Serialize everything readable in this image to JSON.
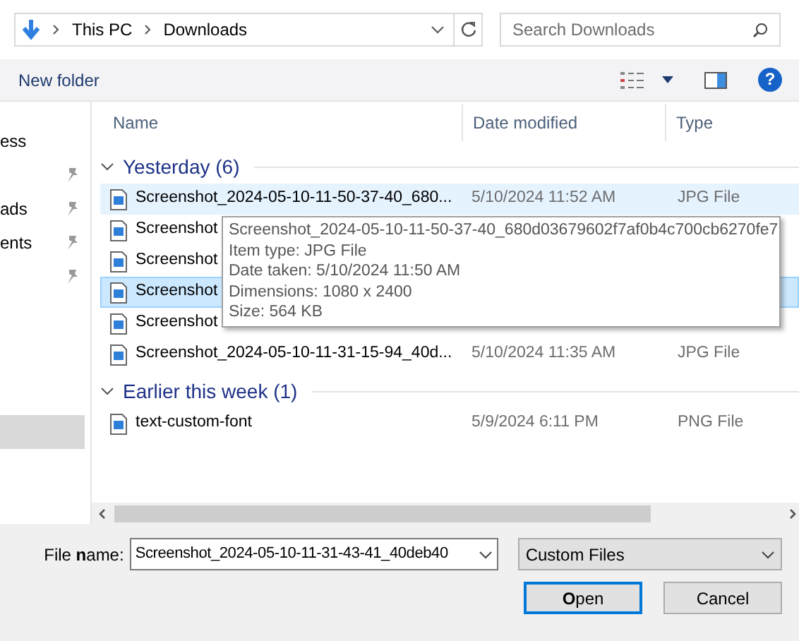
{
  "address_bar": {
    "path": [
      "This PC",
      "Downloads"
    ]
  },
  "search": {
    "placeholder": "Search Downloads"
  },
  "toolbar": {
    "new_folder": "New folder",
    "help": "?"
  },
  "nav_pane": {
    "items": [
      {
        "label": "ess",
        "pinned": false
      },
      {
        "pinned": true
      },
      {
        "label": "ads",
        "pinned": true
      },
      {
        "label": "ents",
        "pinned": true
      },
      {
        "pinned": true
      }
    ]
  },
  "columns": [
    "Name",
    "Date modified",
    "Type"
  ],
  "groups": [
    {
      "title": "Yesterday (6)",
      "expanded": true,
      "files": [
        {
          "name": "Screenshot_2024-05-10-11-50-37-40_680...",
          "date": "5/10/2024 11:52 AM",
          "type": "JPG File",
          "hovered": true,
          "selected": false
        },
        {
          "name": "Screenshot",
          "hovered": false,
          "selected": false
        },
        {
          "name": "Screenshot",
          "hovered": false,
          "selected": false
        },
        {
          "name": "Screenshot",
          "hovered": false,
          "selected": true
        },
        {
          "name": "Screenshot",
          "hovered": false,
          "selected": false
        },
        {
          "name": "Screenshot_2024-05-10-11-31-15-94_40d...",
          "date": "5/10/2024 11:35 AM",
          "type": "JPG File",
          "hovered": false,
          "selected": false
        }
      ]
    },
    {
      "title": "Earlier this week (1)",
      "expanded": true,
      "files": [
        {
          "name": "text-custom-font",
          "date": "5/9/2024 6:11 PM",
          "type": "PNG File",
          "hovered": false,
          "selected": false
        }
      ]
    }
  ],
  "tooltip": [
    "Screenshot_2024-05-10-11-50-37-40_680d03679602f7af0b4c700cb6270fe7",
    "Item type: JPG File",
    "Date taken: 5/10/2024 11:50 AM",
    "Dimensions: 1080 x 2400",
    "Size: 564 KB"
  ],
  "file_name": {
    "label": "File **n**ame:",
    "value": "Screenshot_2024-05-10-11-31-43-41_40deb40"
  },
  "file_type": {
    "value": "Custom Files"
  },
  "buttons": [
    {
      "label": "**O**pen",
      "default": true
    },
    {
      "label": "Cancel",
      "default": false
    }
  ]
}
